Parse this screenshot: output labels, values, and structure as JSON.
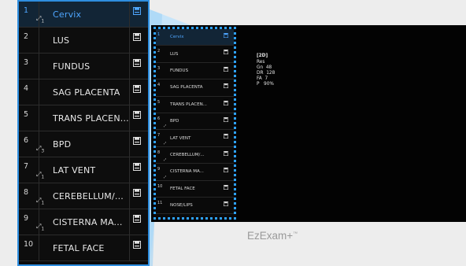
{
  "colors": {
    "accent": "#2e8ee0",
    "active_text": "#4ea6ff",
    "background": "#ededed",
    "panel": "#0b0b0b"
  },
  "exam_list": {
    "items": [
      {
        "index": "1",
        "label": "Cervix",
        "active": true,
        "marker": "1",
        "icon": "save-icon"
      },
      {
        "index": "2",
        "label": "LUS",
        "active": false,
        "marker": "",
        "icon": "save-icon"
      },
      {
        "index": "3",
        "label": "FUNDUS",
        "active": false,
        "marker": "",
        "icon": "save-icon"
      },
      {
        "index": "4",
        "label": "SAG PLACENTA",
        "active": false,
        "marker": "",
        "icon": "save-icon"
      },
      {
        "index": "5",
        "label": "TRANS PLACEN...",
        "active": false,
        "marker": "",
        "icon": "save-icon"
      },
      {
        "index": "6",
        "label": "BPD",
        "active": false,
        "marker": "3",
        "icon": "save-icon"
      },
      {
        "index": "7",
        "label": "LAT VENT",
        "active": false,
        "marker": "1",
        "icon": "save-icon"
      },
      {
        "index": "8",
        "label": "CEREBELLUM/...",
        "active": false,
        "marker": "1",
        "icon": "save-icon"
      },
      {
        "index": "9",
        "label": "CISTERNA MA...",
        "active": false,
        "marker": "1",
        "icon": "save-icon"
      },
      {
        "index": "10",
        "label": "FETAL FACE",
        "active": false,
        "marker": "",
        "icon": "save-icon"
      },
      {
        "index": "11",
        "label": "NOSE/LIPS",
        "active": false,
        "marker": "",
        "icon": "save-icon"
      }
    ]
  },
  "screen_list_labels": {
    "cervix": "Cervix",
    "lus": "LUS",
    "fundus": "FUNDUS",
    "sag": "SAG PLACENTA",
    "trans": "TRANS PLACEN...",
    "bpd": "BPD",
    "latvent": "LAT VENT",
    "cereb": "CEREBELLUM/...",
    "cisterna": "CISTERNA MA...",
    "fetalface": "FETAL FACE",
    "noselips": "NOSE/LIPS"
  },
  "readout": {
    "mode": "[2D]",
    "res_label": "Res",
    "gn_label": "Gn",
    "gn_value": "48",
    "dr_label": "DR",
    "dr_value": "128",
    "fa_label": "FA",
    "fa_value": "7",
    "p_label": "P",
    "p_value": "90%"
  },
  "brand": {
    "name": "EzExam+",
    "trademark": "™"
  }
}
